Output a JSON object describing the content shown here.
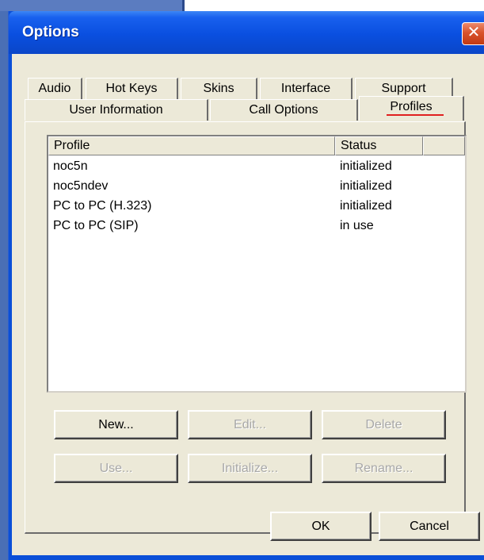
{
  "dialog": {
    "title": "Options",
    "close_glyph": "✕"
  },
  "tabs": {
    "row1": [
      {
        "label": "Audio"
      },
      {
        "label": "Hot Keys"
      },
      {
        "label": "Skins"
      },
      {
        "label": "Interface"
      },
      {
        "label": "Support"
      }
    ],
    "row2": [
      {
        "label": "User Information"
      },
      {
        "label": "Call Options"
      },
      {
        "label": "Profiles",
        "selected": true
      }
    ]
  },
  "profiles": {
    "columns": [
      "Profile",
      "Status"
    ],
    "rows": [
      {
        "profile": "noc5n",
        "status": "initialized"
      },
      {
        "profile": "noc5ndev",
        "status": "initialized"
      },
      {
        "profile": "PC to PC (H.323)",
        "status": "initialized"
      },
      {
        "profile": "PC to PC (SIP)",
        "status": "in use"
      }
    ],
    "buttons": {
      "new": "New...",
      "edit": "Edit...",
      "delete": "Delete",
      "use": "Use...",
      "initialize": "Initialize...",
      "rename": "Rename..."
    }
  },
  "footer": {
    "ok": "OK",
    "cancel": "Cancel"
  },
  "colors": {
    "title_bar": "#0a4fd8",
    "face": "#ece9d8",
    "close": "#d9532c",
    "tab_marker": "#e02020",
    "disabled_text": "#a8a8a8"
  }
}
